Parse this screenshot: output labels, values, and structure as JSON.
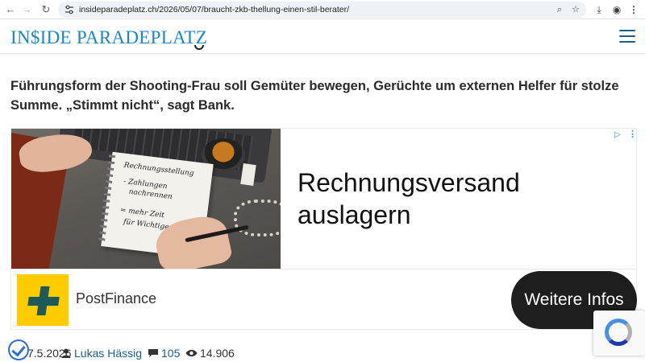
{
  "browser": {
    "url": "insideparadeplatz.ch/2026/05/07/braucht-zkb-thellung-einen-stil-berater/",
    "icons": [
      "back-arrow-icon",
      "forward-arrow-icon",
      "reload-icon",
      "site-info-icon",
      "zoom-icon",
      "bookmark-star-icon",
      "download-icon",
      "profile-icon",
      "menu-dots-icon"
    ]
  },
  "site": {
    "logo": "IN$IDE PARADEPLATZ",
    "accent_color": "#1a87c9"
  },
  "article": {
    "lead": "Führungsform der Shooting-Frau soll Gemüter bewegen, Gerüchte um externen Helfer für stolze Summe. „Stimmt nicht“, sagt Bank.",
    "meta": {
      "date": "7.5.2026",
      "author": "Lukas Hässig",
      "comments": "105",
      "views": "14.906"
    }
  },
  "ad": {
    "headline_line1": "Rechnungsversand",
    "headline_line2": "auslagern",
    "brand": "PostFinance",
    "cta": "Weitere Infos",
    "notebook": {
      "line1": "Rechnungsstellung",
      "line2": "- Zahlungen",
      "line3": "nachrennen",
      "line4": "= mehr Zeit",
      "line5": "für Wichtiges"
    },
    "brand_color": "#ffcc00"
  }
}
